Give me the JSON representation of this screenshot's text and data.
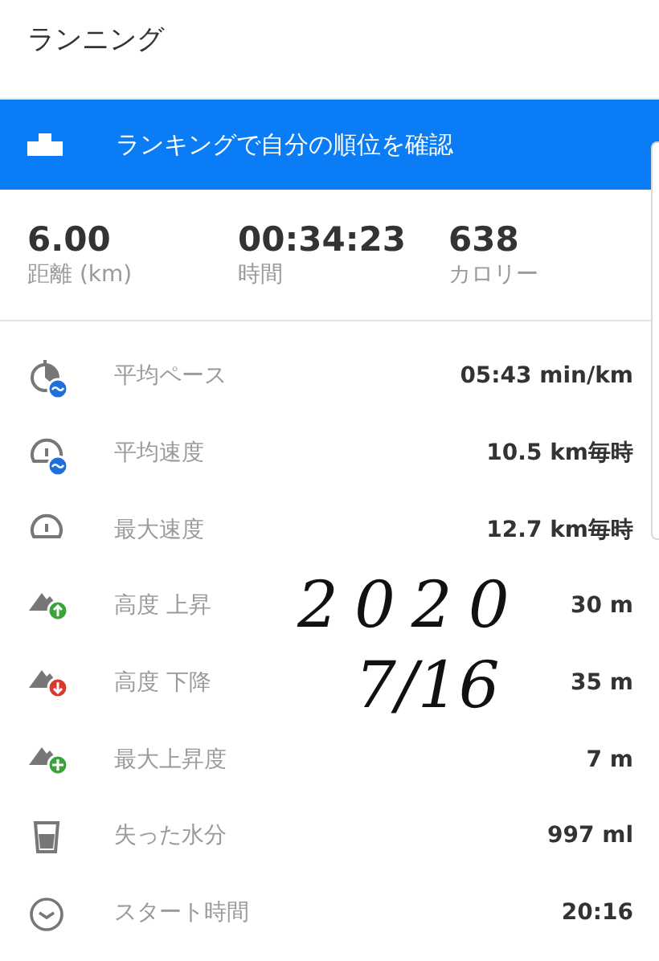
{
  "header": {
    "title": "ランニング"
  },
  "banner": {
    "label": "ランキングで自分の順位を確認"
  },
  "summary": [
    {
      "value": "6.00",
      "label": "距離 (km)"
    },
    {
      "value": "00:34:23",
      "label": "時間"
    },
    {
      "value": "638",
      "label": "カロリー"
    }
  ],
  "metrics": [
    {
      "kind": "pace",
      "label": "平均ペース",
      "value": "05:43 min/km"
    },
    {
      "kind": "speed",
      "label": "平均速度",
      "value": "10.5 km毎時"
    },
    {
      "kind": "max_speed",
      "label": "最大速度",
      "value": "12.7 km毎時"
    },
    {
      "kind": "ascent",
      "label": "高度 上昇",
      "value": "30 m"
    },
    {
      "kind": "descent",
      "label": "高度 下降",
      "value": "35 m"
    },
    {
      "kind": "max_ascent",
      "label": "最大上昇度",
      "value": "7 m"
    },
    {
      "kind": "water",
      "label": "失った水分",
      "value": "997 ml"
    },
    {
      "kind": "clock",
      "label": "スタート時間",
      "value": "20:16"
    }
  ],
  "handwritten_note": [
    "2020",
    "7/16"
  ]
}
